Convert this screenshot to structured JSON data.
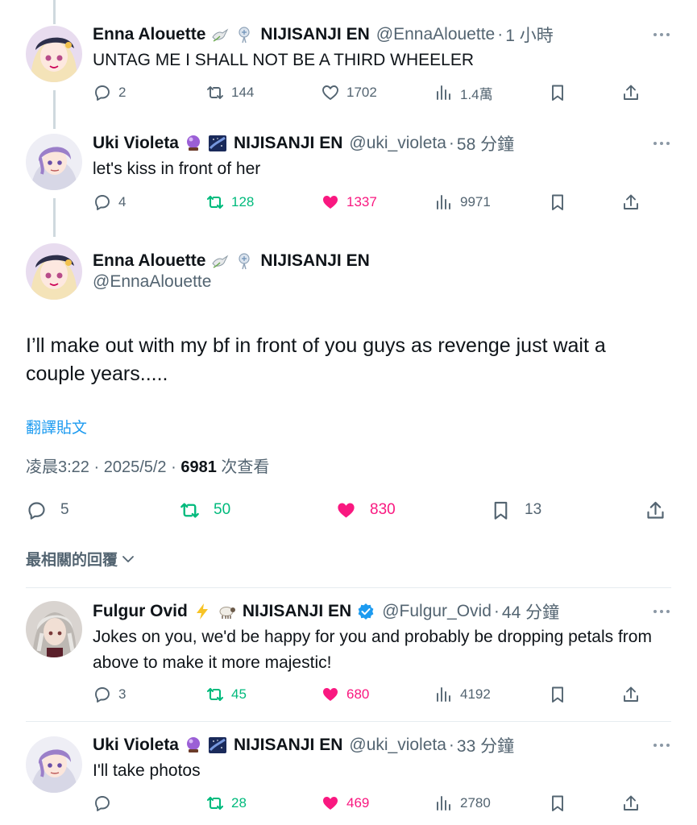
{
  "replies_top": [
    {
      "name": "Enna Alouette",
      "emojis": [
        "dove-emoji",
        "hairpin-emoji"
      ],
      "org": "NIJISANJI EN",
      "handle": "@EnnaAlouette",
      "time": "1 小時",
      "text": "UNTAG ME I SHALL NOT BE A THIRD WHEELER",
      "replies": "2",
      "reposts": "144",
      "likes": "1702",
      "views": "1.4萬",
      "liked": false,
      "reposted": false
    },
    {
      "name": "Uki Violeta",
      "emojis": [
        "crystal-ball-emoji",
        "milky-way-emoji"
      ],
      "org": "NIJISANJI EN",
      "handle": "@uki_violeta",
      "time": "58 分鐘",
      "text": "let's kiss in front of her",
      "replies": "4",
      "reposts": "128",
      "likes": "1337",
      "views": "9971",
      "liked": true,
      "reposted": true
    }
  ],
  "main_tweet": {
    "name": "Enna Alouette",
    "org": "NIJISANJI EN",
    "handle": "@EnnaAlouette",
    "text": "I’ll make out with my bf in front of you guys as revenge just wait a couple years.....",
    "translate_label": "翻譯貼文",
    "time": "凌晨3:22 · 2025/5/2 · ",
    "views_count": "6981",
    "views_label": " 次查看",
    "replies": "5",
    "reposts": "50",
    "likes": "830",
    "bookmarks": "13"
  },
  "sort_label": "最相關的回覆",
  "replies_bottom": [
    {
      "name": "Fulgur Ovid",
      "org": "NIJISANJI EN",
      "handle": "@Fulgur_Ovid",
      "time": "44 分鐘",
      "text": "Jokes on you, we'd be happy for you and probably be dropping petals from above to make it more majestic!",
      "replies": "3",
      "reposts": "45",
      "likes": "680",
      "views": "4192"
    },
    {
      "name": "Uki Violeta",
      "org": "NIJISANJI EN",
      "handle": "@uki_violeta",
      "time": "33 分鐘",
      "text": "I'll take photos",
      "replies": "",
      "reposts": "28",
      "likes": "469",
      "views": "2780"
    }
  ],
  "colors": {
    "text": "#0f1419",
    "secondary": "#536471",
    "accent_blue": "#1d9bf0",
    "repost_green": "#00ba7c",
    "like_pink": "#f91880"
  }
}
